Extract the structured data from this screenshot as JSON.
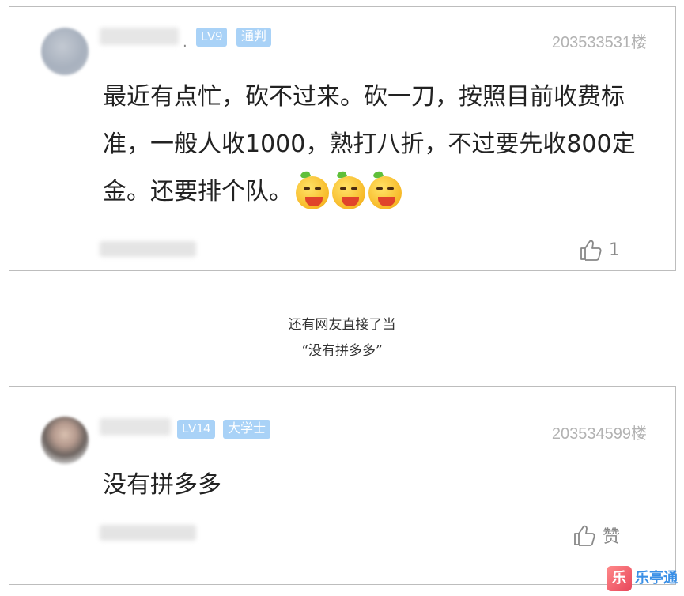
{
  "comments": [
    {
      "level": "LV9",
      "title_badge": "通判",
      "floor": "203533531楼",
      "text": "最近有点忙，砍不过来。砍一刀，按照目前收费标准，一般人收1000，熟打八折，不过要先收800定金。还要排个队。",
      "emoji_count": 3,
      "like_label": "1"
    },
    {
      "level": "LV14",
      "title_badge": "大学士",
      "floor": "203534599楼",
      "text": "没有拼多多",
      "like_label": "赞"
    }
  ],
  "captions": {
    "line1": "还有网友直接了当",
    "line2": "“没有拼多多”"
  },
  "watermark": {
    "logo_char": "乐",
    "name": "乐亭通"
  },
  "icons": {
    "like": "thumbs-up-icon",
    "emoji": "grin-fruit-emoji-icon"
  },
  "colors": {
    "badge": "#a9d2f7",
    "floor_text": "#b2b2b2",
    "watermark": "#3a8fe6"
  }
}
